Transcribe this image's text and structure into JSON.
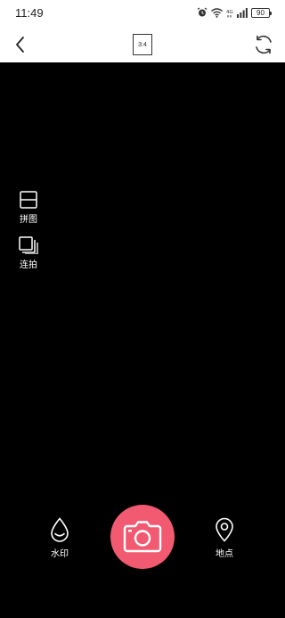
{
  "status_bar": {
    "time": "11:49",
    "battery": "90",
    "icons": [
      "alarm-icon",
      "wifi-icon",
      "4g-icon",
      "signal-icon",
      "battery-icon"
    ]
  },
  "top_bar": {
    "back_icon": "chevron-left-icon",
    "ratio_label": "3:4",
    "switch_icon": "camera-switch-icon"
  },
  "side_tools": [
    {
      "label": "拼图",
      "icon": "collage-icon"
    },
    {
      "label": "连拍",
      "icon": "burst-icon"
    }
  ],
  "bottom_tools": {
    "watermark_label": "水印",
    "watermark_icon": "watermark-drop-icon",
    "location_label": "地点",
    "location_icon": "location-pin-icon",
    "shutter_icon": "camera-icon"
  },
  "colors": {
    "shutter": "#f25a71",
    "viewfinder": "#000000",
    "header": "#ffffff"
  }
}
